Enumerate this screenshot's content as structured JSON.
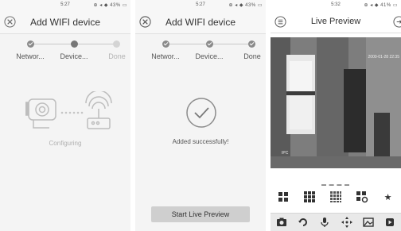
{
  "screen1": {
    "status_time": "5:27",
    "status_icons": "⊕ ◂ ◆ 43% ▭",
    "title": "Add WIFI device",
    "steps": [
      "Networ...",
      "Device...",
      "Done"
    ],
    "content": "Configuring"
  },
  "screen2": {
    "status_time": "5:27",
    "status_icons": "⊕ ◂ ◆ 43% ▭",
    "title": "Add WIFI device",
    "steps": [
      "Networ...",
      "Device...",
      "Done"
    ],
    "content": "Added successfully!",
    "button": "Start Live Preview"
  },
  "screen3": {
    "status_time": "5:32",
    "status_icons": "⊕ ◂ ◆ 41% ▭",
    "title": "Live Preview",
    "timestamp": "2000-01-28 22:35",
    "camera_label": "IPC",
    "page_indicator": "▬ ▬ ▬ ▬"
  },
  "colors": {
    "accent": "#8a8a8a",
    "pending": "#d4d4d4",
    "button": "#cfcfcf"
  }
}
